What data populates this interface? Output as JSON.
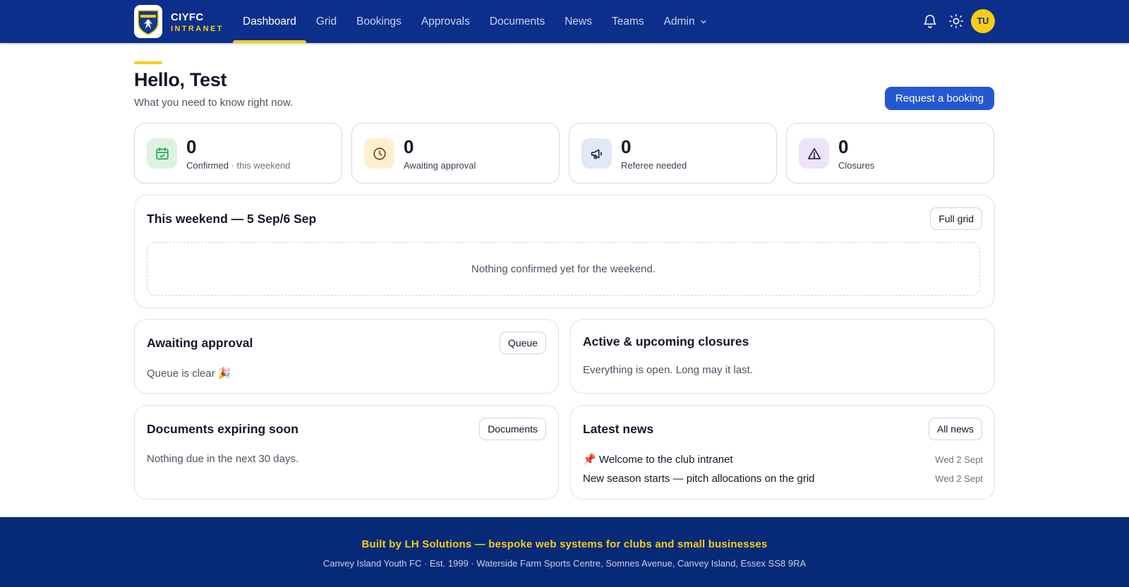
{
  "brand": {
    "name": "CIYFC",
    "sub": "INTRANET",
    "crest_text": "CANVEY"
  },
  "nav": {
    "items": [
      {
        "label": "Dashboard"
      },
      {
        "label": "Grid"
      },
      {
        "label": "Bookings"
      },
      {
        "label": "Approvals"
      },
      {
        "label": "Documents"
      },
      {
        "label": "News"
      },
      {
        "label": "Teams"
      },
      {
        "label": "Admin"
      }
    ],
    "active": "Dashboard"
  },
  "user": {
    "initials": "TU"
  },
  "icons": [
    "bell-icon",
    "sun-icon",
    "chevron-down-icon",
    "calendar-check-icon",
    "clock-icon",
    "megaphone-icon",
    "warning-icon",
    "pin-icon"
  ],
  "header": {
    "greeting": "Hello, Test",
    "subline": "What you need to know right now.",
    "request_button": "Request a booking"
  },
  "stats": [
    {
      "value": "0",
      "label": "Confirmed",
      "suffix": " · this weekend",
      "icon": "calendar-check-icon",
      "color": "#16a34a",
      "bg": "#dcf3e4"
    },
    {
      "value": "0",
      "label": "Awaiting approval",
      "icon": "clock-icon",
      "color": "#92400e",
      "bg": "#fdf0cf"
    },
    {
      "value": "0",
      "label": "Referee needed",
      "icon": "megaphone-icon",
      "color": "#1e3a8a",
      "bg": "#e1e8f6"
    },
    {
      "value": "0",
      "label": "Closures",
      "icon": "warning-icon",
      "color": "#4c1d95",
      "bg": "#ede4f8"
    }
  ],
  "weekend": {
    "title": "This weekend — 5 Sep/6 Sep",
    "button": "Full grid",
    "empty": "Nothing confirmed yet for the weekend."
  },
  "approval": {
    "title": "Awaiting approval",
    "button": "Queue",
    "text": "Queue is clear 🎉"
  },
  "closures": {
    "title": "Active & upcoming closures",
    "text": "Everything is open. Long may it last."
  },
  "documents": {
    "title": "Documents expiring soon",
    "button": "Documents",
    "text": "Nothing due in the next 30 days."
  },
  "news": {
    "title": "Latest news",
    "button": "All news",
    "items": [
      {
        "pin": "📌",
        "title": "Welcome to the club intranet",
        "date": "Wed 2 Sept"
      },
      {
        "pin": "",
        "title": "New season starts — pitch allocations on the grid",
        "date": "Wed 2 Sept"
      }
    ]
  },
  "footer": {
    "line1": "Built by LH Solutions — bespoke web systems for clubs and small businesses",
    "line2": "Canvey Island Youth FC · Est. 1999 · Waterside Farm Sports Centre, Somnes Avenue, Canvey Island, Essex SS8 9RA"
  },
  "colors": {
    "navy": "#0b2f8a",
    "yellow": "#facc15",
    "primary": "#2458d0",
    "footer": "#072a78"
  }
}
